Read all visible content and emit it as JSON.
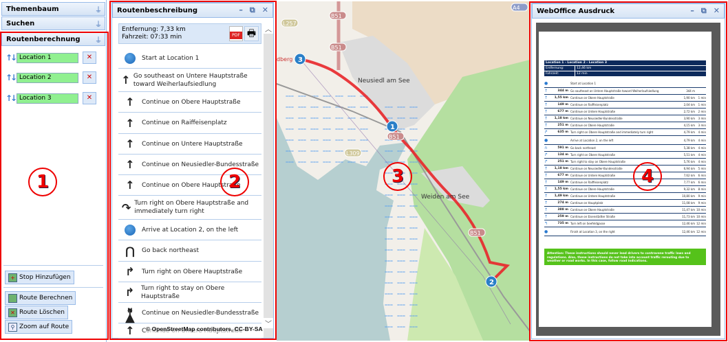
{
  "left": {
    "themenbaum": "Themenbaum",
    "suchen": "Suchen",
    "routenberechnung": "Routenberechnung",
    "locations": [
      "Location 1",
      "Location 2",
      "Location 3"
    ],
    "stop_add": "Stop Hinzufügen",
    "route_calc": "Route Berechnen",
    "route_delete": "Route Löschen",
    "zoom_route": "Zoom auf Route"
  },
  "route": {
    "title": "Routenbeschreibung",
    "distance": "Entfernung: 7,33 km",
    "duration": "Fahrzeit: 07:33 min",
    "steps": [
      {
        "icon": "dot",
        "text": "Start at Location 1"
      },
      {
        "icon": "up",
        "text": "Go southeast on Untere Hauptstraße toward Weiherlaufsiedlung"
      },
      {
        "icon": "up",
        "text": "Continue on Obere Hauptstraße"
      },
      {
        "icon": "up",
        "text": "Continue on Raiffeisenplatz"
      },
      {
        "icon": "up",
        "text": "Continue on Untere Hauptstraße"
      },
      {
        "icon": "up",
        "text": "Continue on Neusiedler-Bundesstraße"
      },
      {
        "icon": "up",
        "text": "Continue on Obere Hauptstraße"
      },
      {
        "icon": "turn-right",
        "text": "Turn right on Obere Hauptstraße and immediately turn right"
      },
      {
        "icon": "dot",
        "text": "Arrive at Location 2, on the left"
      },
      {
        "icon": "u-turn",
        "text": "Go back northeast"
      },
      {
        "icon": "right",
        "text": "Turn right on Obere Hauptstraße"
      },
      {
        "icon": "right",
        "text": "Turn right to stay on Obere Hauptstraße"
      },
      {
        "icon": "up",
        "text": "Continue on Neusiedler-Bundesstraße"
      },
      {
        "icon": "up",
        "text": "Continue on Untere Hauptstraße"
      }
    ],
    "attribution": "© OpenStreetMap contributors, CC-BY-SA",
    "north": "N"
  },
  "map": {
    "labels": [
      "B51",
      "B51",
      "B51",
      "B51",
      "L257",
      "L309",
      "A4",
      "Neusiedl am See",
      "Weiden am See",
      "dberg"
    ],
    "markers": [
      "1",
      "2",
      "3"
    ]
  },
  "print": {
    "title": "WebOffice Ausdruck",
    "heading": "Location 1 - Location 2 - Location 3",
    "distance_label": "Entfernung:",
    "distance_value": "12,46 km",
    "time_label": "Fahrzeit:",
    "time_value": "12 min",
    "rows": [
      [
        "●",
        "",
        "Start at Location 1",
        "",
        ""
      ],
      [
        "↑",
        "344 m",
        "Go southeast on Untere Hauptstraße toward Weiherlaufsiedlung",
        "344 m",
        ""
      ],
      [
        "↑",
        "1,55 km",
        "Continue on Obere Hauptstraße",
        "1,90 km",
        "1 min"
      ],
      [
        "↑",
        "149 m",
        "Continue on Raiffeisenplatz",
        "2,04 km",
        "1 min"
      ],
      [
        "↑",
        "677 m",
        "Continue on Untere Hauptstraße",
        "2,72 km",
        "2 min"
      ],
      [
        "↑",
        "1,18 km",
        "Continue on Neusiedler-Bundesstraße",
        "3,90 km",
        "3 min"
      ],
      [
        "↑",
        "251 m",
        "Continue on Obere Hauptstraße",
        "4,15 km",
        "3 min"
      ],
      [
        "↱",
        "635 m",
        "Turn right on Obere Hauptstraße and immediately turn right",
        "4,79 km",
        "4 min"
      ],
      [
        "●",
        "",
        "Arrive at Location 2, on the left",
        "4,79 km",
        "4 min"
      ],
      [
        "∩",
        "591 m",
        "Go back northeast",
        "5,38 km",
        "4 min"
      ],
      [
        "↱",
        "134 m",
        "Turn right on Obere Hauptstraße",
        "5,51 km",
        "4 min"
      ],
      [
        "↱",
        "251 m",
        "Turn right to stay on Obere Hauptstraße",
        "5,76 km",
        "4 min"
      ],
      [
        "↑",
        "1,18 km",
        "Continue on Neusiedler-Bundesstraße",
        "6,94 km",
        "5 min"
      ],
      [
        "↑",
        "677 m",
        "Continue on Untere Hauptstraße",
        "7,62 km",
        "6 min"
      ],
      [
        "↑",
        "149 m",
        "Continue on Raiffeisenplatz",
        "7,77 km",
        "6 min"
      ],
      [
        "↑",
        "1,55 km",
        "Continue on Obere Hauptstraße",
        "9,32 km",
        "8 min"
      ],
      [
        "↑",
        "1,49 km",
        "Continue on Untere Hauptstraße",
        "10,80 km",
        "9 min"
      ],
      [
        "↑",
        "274 m",
        "Continue on Hauptplatz",
        "11,08 km",
        "9 min"
      ],
      [
        "↑",
        "388 m",
        "Continue on Obere Hauptstraße",
        "11,47 km",
        "10 min"
      ],
      [
        "↑",
        "259 m",
        "Continue on Eisenstädter Straße",
        "11,73 km",
        "10 min"
      ],
      [
        "↰",
        "735 m",
        "Turn left on Seefeldgasse",
        "12,46 km",
        "12 min"
      ],
      [
        "●",
        "",
        "Finish at Location 3, on the right",
        "12,46 km",
        "12 min"
      ]
    ],
    "warning": "Attention: These instructions should never lead drivers to contravene traffic laws and regulations. Also, these instructions do not take into account traffic rerouting due to weather or road works. In this case, follow road indications."
  },
  "annotations": [
    "1",
    "2",
    "3",
    "4"
  ]
}
